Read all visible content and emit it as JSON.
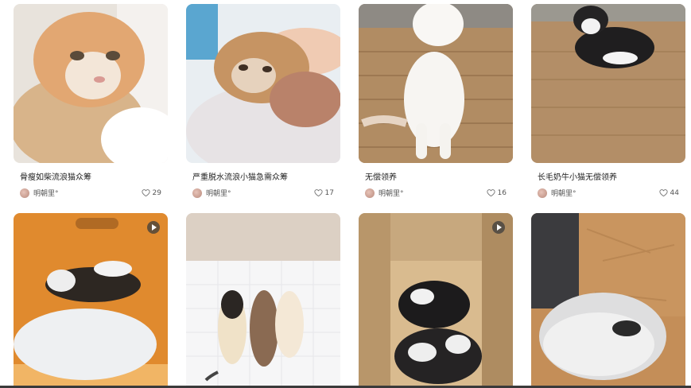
{
  "cards": [
    {
      "title": "骨瘦如柴流浪猫众筹",
      "author": "明朝里°",
      "likes": "29"
    },
    {
      "title": "严重脱水流浪小猫急需众筹",
      "author": "明朝里°",
      "likes": "17"
    },
    {
      "title": "无偿领养",
      "author": "明朝里°",
      "likes": "16"
    },
    {
      "title": "长毛奶牛小猫无偿领养",
      "author": "明朝里°",
      "likes": "44"
    }
  ],
  "photos": [
    "orange-white-kitten-closeup",
    "orange-kitten-held-in-hand",
    "white-kitten-on-mat",
    "black-white-kitten-on-mat",
    "kitten-in-orange-box",
    "newborn-kittens-on-pad",
    "kittens-in-cardboard-box",
    "kitten-in-fluffy-bed"
  ],
  "colors": {
    "text": "#222222",
    "meta": "#555555"
  }
}
